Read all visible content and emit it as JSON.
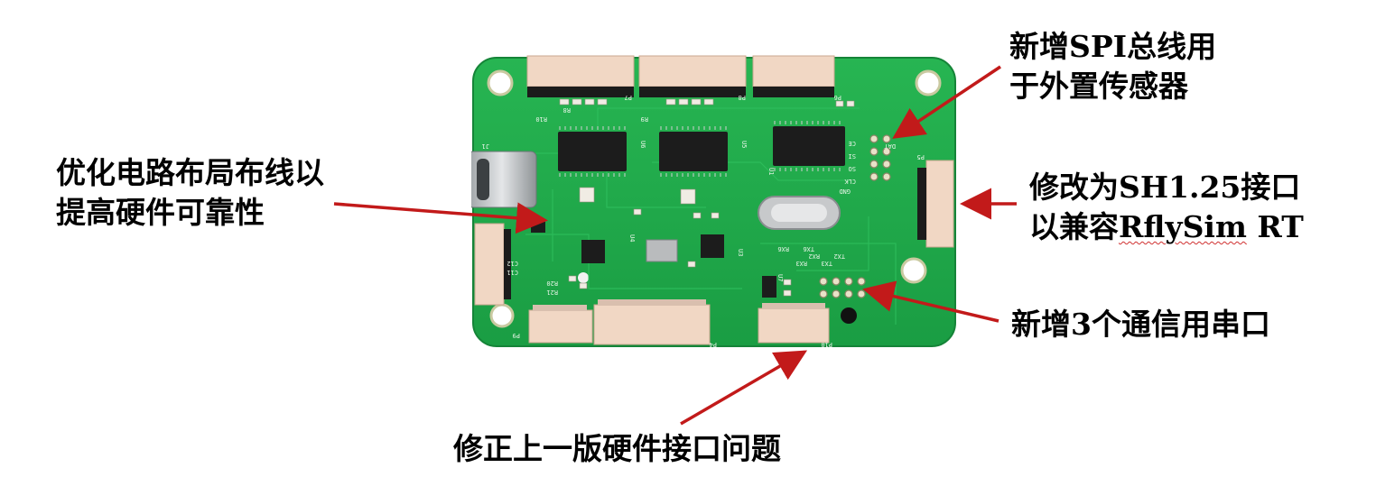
{
  "annotations": {
    "spi": {
      "line1": "新增SPI总线用",
      "line2": "于外置传感器"
    },
    "routing": {
      "line1": "优化电路布局布线以",
      "line2": "提高硬件可靠性"
    },
    "sh125": {
      "line1_prefix": "修改为SH1.25接口",
      "line2_prefix": "以兼容",
      "line2_product": "RflySim",
      "line2_suffix": " RT"
    },
    "uart": {
      "text": "新增3个通信用串口"
    },
    "fix": {
      "text": "修正上一版硬件接口问题"
    }
  },
  "board_silkscreen": {
    "connectors": [
      "P7",
      "P8",
      "P6",
      "P5",
      "P9",
      "P4",
      "P10"
    ],
    "chips": [
      "U6",
      "U5",
      "U4",
      "U3",
      "U7",
      "U1"
    ],
    "spi_pins": [
      "CE",
      "SI",
      "SO",
      "CLK"
    ],
    "uart_pins": [
      "RX3",
      "TX3",
      "RX2",
      "TX2",
      "RX6",
      "TX6"
    ],
    "misc": [
      "J1",
      "GND",
      "DAT",
      "R10",
      "R9",
      "R8",
      "C12",
      "C11",
      "R20",
      "R21"
    ]
  },
  "colors": {
    "pcb": "#1fa84a",
    "pcb_edge": "#178c3c",
    "arrow": "#c21a1a",
    "connector": "#f1d7c4",
    "chip": "#1c1c1c"
  }
}
